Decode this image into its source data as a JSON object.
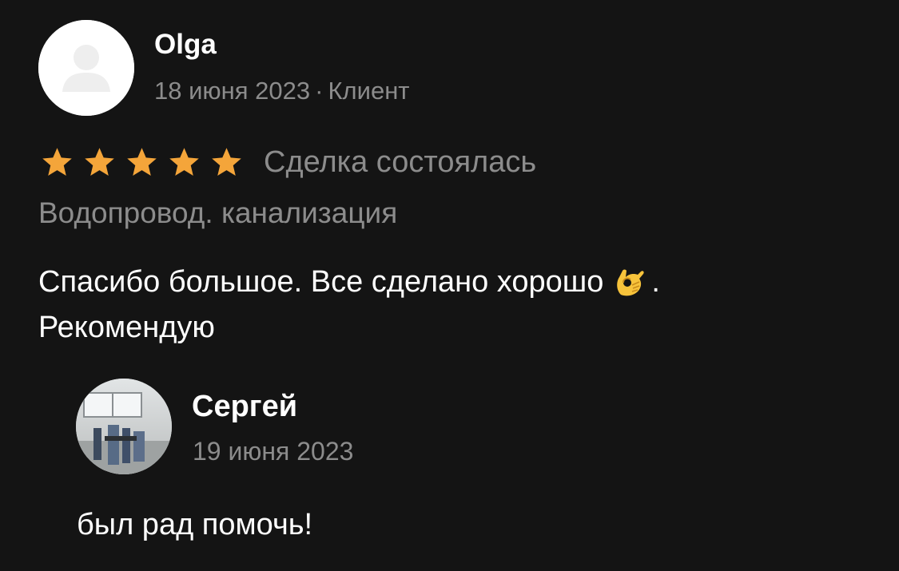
{
  "review": {
    "author": "Olga",
    "date": "18 июня 2023",
    "separator": "·",
    "role": "Клиент",
    "rating": 5,
    "rating_max": 5,
    "star_color": "#f4a53a",
    "deal_status": "Сделка состоялась",
    "category": "Водопровод. канализация",
    "text_line1": "Спасибо большое. Все сделано хорошо",
    "emoji": "👌",
    "text_line1_end": ".",
    "text_line2": "Рекомендую"
  },
  "reply": {
    "author": "Сергей",
    "date": "19 июня 2023",
    "text": "был рад помочь!"
  },
  "colors": {
    "background": "#141414",
    "primary_text": "#ffffff",
    "secondary_text": "#8c8c8c"
  }
}
